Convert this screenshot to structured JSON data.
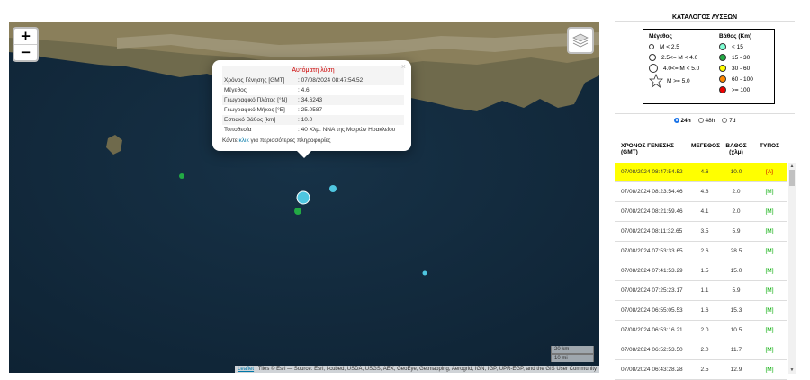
{
  "map": {
    "zoom_in": "+",
    "zoom_out": "−",
    "layers_icon": "layers-icon",
    "scale_km": "20 km",
    "scale_mi": "10 mi",
    "attribution_link": "Leaflet",
    "attribution_text": " | Tiles © Esri — Source: Esri, i-cubed, USDA, USGS, AEX, GeoEye, Getmapping, Aerogrid, IGN, IGP, UPR-EGP, and the GIS User Community"
  },
  "popup": {
    "title": "Αυτόματη λύση",
    "close": "×",
    "rows": [
      {
        "key": "Χρόνος Γένησης [GMT]",
        "value": ": 07/08/2024 08:47:54.52"
      },
      {
        "key": "Μέγεθος",
        "value": ": 4.6"
      },
      {
        "key": "Γεωγραφικό Πλάτος [°N]",
        "value": ": 34.6243"
      },
      {
        "key": "Γεωγραφικό Μήκος [°E]",
        "value": ": 25.0587"
      },
      {
        "key": "Εστιακό Βάθος [km]",
        "value": ": 10.0"
      },
      {
        "key": "Τοποθεσία",
        "value": ": 40 Χλμ. ΝΝΑ της Μοιρών Ηρακλείου"
      }
    ],
    "more_prefix": "Κάντε ",
    "more_link": "κλικ",
    "more_suffix": " για περισσότερες πληροφορίες"
  },
  "catalog": {
    "title": "ΚΑΤΑΛΟΓΟΣ ΛΥΣΕΩΝ",
    "legend": {
      "magnitude_header": "Μέγεθος",
      "magnitude_items": [
        "M < 2.5",
        "2.5<= M < 4.0",
        "4.0<= M < 5.0",
        "M >= 5.0"
      ],
      "depth_header": "Βάθος (Km)",
      "depth_items": [
        {
          "label": "< 15",
          "color": "#7fffd4"
        },
        {
          "label": "15 - 30",
          "color": "#22aa44"
        },
        {
          "label": "30 - 60",
          "color": "#ffff00"
        },
        {
          "label": "60 - 100",
          "color": "#ff8800"
        },
        {
          "label": ">= 100",
          "color": "#ee0000"
        }
      ]
    },
    "period": {
      "options": [
        "24h",
        "48h",
        "7d"
      ],
      "selected": "24h"
    },
    "table": {
      "headers": [
        "ΧΡΟΝΟΣ ΓΕΝΕΣΗΣ (GMT)",
        "ΜΕΓΕΘΟΣ",
        "ΒΑΘΟΣ (χλμ)",
        "ΤΥΠΟΣ"
      ],
      "rows": [
        [
          "07/08/2024 08:47:54.52",
          "4.6",
          "10.0",
          "[A]"
        ],
        [
          "07/08/2024 08:23:54.46",
          "4.8",
          "2.0",
          "[M]"
        ],
        [
          "07/08/2024 08:21:59.46",
          "4.1",
          "2.0",
          "[M]"
        ],
        [
          "07/08/2024 08:11:32.65",
          "3.5",
          "5.9",
          "[M]"
        ],
        [
          "07/08/2024 07:53:33.65",
          "2.6",
          "28.5",
          "[M]"
        ],
        [
          "07/08/2024 07:41:53.29",
          "1.5",
          "15.0",
          "[M]"
        ],
        [
          "07/08/2024 07:25:23.17",
          "1.1",
          "5.9",
          "[M]"
        ],
        [
          "07/08/2024 06:55:05.53",
          "1.6",
          "15.3",
          "[M]"
        ],
        [
          "07/08/2024 06:53:16.21",
          "2.0",
          "10.5",
          "[M]"
        ],
        [
          "07/08/2024 06:52:53.50",
          "2.0",
          "11.7",
          "[M]"
        ],
        [
          "07/08/2024 06:43:28.28",
          "2.5",
          "12.9",
          "[M]"
        ]
      ]
    }
  }
}
